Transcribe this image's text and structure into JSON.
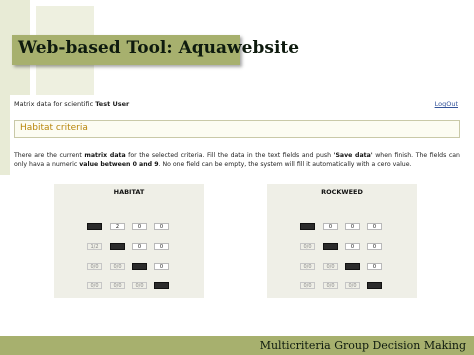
{
  "slide": {
    "title": "Web-based Tool: Aquawebsite",
    "footer": "Multicriteria Group Decision Making"
  },
  "header": {
    "user_prefix": "Matrix data for scientific",
    "user_name": "Test User",
    "logout": "LogOut"
  },
  "criteria": {
    "title": "Habitat criteria"
  },
  "description": {
    "part1": "There are the current ",
    "bold1": "matrix data",
    "part2": " for the selected criteria. Fill the data in the text fields and push ",
    "bold2": "'Save data'",
    "part3": " when finish. The fields can only hava a numeric ",
    "bold3": "value between 0 and 9",
    "part4": ". No one field can be empty, the system will fill it automatically with a cero value."
  },
  "matrices": [
    {
      "title": "HABITAT",
      "rows": [
        [
          "",
          "2",
          "0",
          "0"
        ],
        [
          "1/2",
          "",
          "0",
          "0"
        ],
        [
          "0/0",
          "0/0",
          "",
          "0"
        ],
        [
          "0/0",
          "0/0",
          "0/0",
          ""
        ]
      ]
    },
    {
      "title": "ROCKWEED",
      "rows": [
        [
          "",
          "0",
          "0",
          "0"
        ],
        [
          "0/0",
          "",
          "0",
          "0"
        ],
        [
          "0/0",
          "0/0",
          "",
          "0"
        ],
        [
          "0/0",
          "0/0",
          "0/0",
          ""
        ]
      ]
    }
  ],
  "colors": {
    "slide_accent": "#a7b06e",
    "criteria_title": "#b8860b",
    "link": "#33539a",
    "panel_bg": "#efefe7"
  }
}
